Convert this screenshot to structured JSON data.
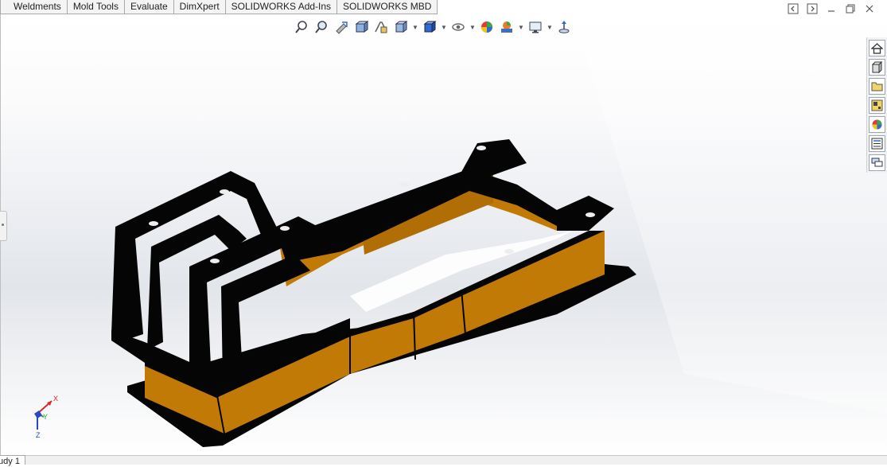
{
  "tabs": [
    "Weldments",
    "Mold Tools",
    "Evaluate",
    "DimXpert",
    "SOLIDWORKS Add-Ins",
    "SOLIDWORKS MBD"
  ],
  "hud_icons": [
    "zoom-to-fit-icon",
    "zoom-to-area-icon",
    "previous-view-icon",
    "section-view-icon",
    "dynamic-annotation-icon",
    "view-orientation-icon",
    "display-style-icon",
    "hide-show-items-icon",
    "edit-appearance-icon",
    "apply-scene-icon",
    "view-settings-icon",
    "rotate-icon"
  ],
  "window_controls": [
    "tile-left-icon",
    "tile-right-icon",
    "minimize-icon",
    "restore-icon",
    "close-icon"
  ],
  "task_pane": [
    "home-icon",
    "design-library-icon",
    "file-explorer-icon",
    "view-palette-icon",
    "appearances-icon",
    "custom-properties-icon",
    "forum-icon"
  ],
  "triad": {
    "x": "X",
    "y": "Y",
    "z": "Z"
  },
  "bottom_tab": "tudy 1",
  "colors": {
    "model_orange": "#c17a06",
    "model_black": "#050505",
    "accent_blue": "#2d6bd6"
  }
}
